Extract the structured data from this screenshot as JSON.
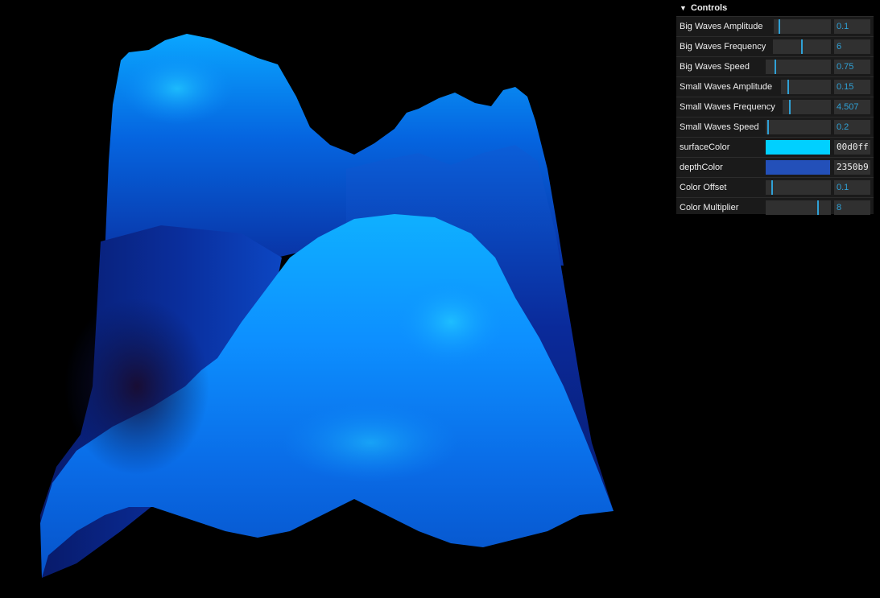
{
  "gui": {
    "title": "Controls",
    "controls": [
      {
        "label": "Big Waves Amplitude",
        "value": "0.1",
        "fraction": 0.1
      },
      {
        "label": "Big Waves Frequency",
        "value": "6",
        "fraction": 0.5
      },
      {
        "label": "Big Waves Speed",
        "value": "0.75",
        "fraction": 0.15
      },
      {
        "label": "Small Waves Amplitude",
        "value": "0.15",
        "fraction": 0.15
      },
      {
        "label": "Small Waves Frequency",
        "value": "4.507",
        "fraction": 0.15
      },
      {
        "label": "Small Waves Speed",
        "value": "0.2",
        "fraction": 0.04
      },
      {
        "label": "surfaceColor",
        "value": "00d0ff",
        "color": "#00d0ff"
      },
      {
        "label": "depthColor",
        "value": "2350b9",
        "color": "#2350b9"
      },
      {
        "label": "Color Offset",
        "value": "0.1",
        "fraction": 0.1
      },
      {
        "label": "Color Multiplier",
        "value": "8",
        "fraction": 0.8
      }
    ]
  },
  "colors": {
    "accent": "#2fa1d6",
    "background": "#000000",
    "panel": "#1a1a1a"
  }
}
